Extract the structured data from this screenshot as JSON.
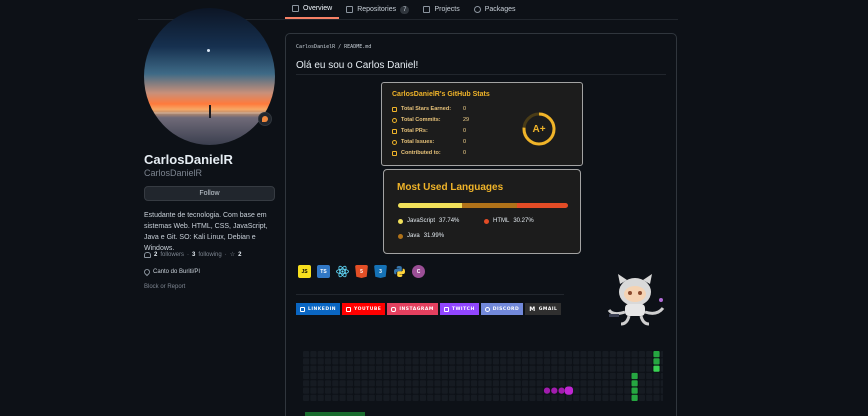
{
  "tabs": [
    {
      "label": "Overview",
      "icon": "book-icon",
      "active": true
    },
    {
      "label": "Repositories",
      "icon": "repo-icon",
      "count": "7"
    },
    {
      "label": "Projects",
      "icon": "table-icon"
    },
    {
      "label": "Packages",
      "icon": "package-icon"
    }
  ],
  "profile": {
    "fullname": "CarlosDanielR",
    "username": "CarlosDanielR",
    "follow_label": "Follow",
    "bio": "Estudante de tecnologia. Com base em sistemas Web. HTML, CSS, JavaScript, Java e Git. SO: Kali Linux, Debian e Windows.",
    "followers_count": "2",
    "followers_label": "followers",
    "separator": "·",
    "following_count": "3",
    "following_label": "following",
    "stars_count": "2",
    "location": "Canto do Buriti/PI",
    "block_label": "Block or Report"
  },
  "readme": {
    "path": "CarlosDanielR / README.md",
    "title": "Olá eu sou o Carlos Daniel!"
  },
  "stats_card": {
    "title": "CarlosDanielR's GitHub Stats",
    "rows": [
      {
        "label": "Total Stars Earned:",
        "value": "0",
        "icon": "star-icon"
      },
      {
        "label": "Total Commits:",
        "value": "29",
        "icon": "history-icon"
      },
      {
        "label": "Total PRs:",
        "value": "0",
        "icon": "pull-request-icon"
      },
      {
        "label": "Total Issues:",
        "value": "0",
        "icon": "issue-icon"
      },
      {
        "label": "Contributed to:",
        "value": "0",
        "icon": "repo-icon"
      }
    ],
    "grade": "A+",
    "accent": "#f0b429"
  },
  "languages_card": {
    "title": "Most Used Languages",
    "languages": [
      {
        "name": "JavaScript",
        "percent": "37.74%",
        "value": 37.74,
        "color": "#f1e05a"
      },
      {
        "name": "HTML",
        "percent": "30.27%",
        "value": 30.27,
        "color": "#e34c26"
      },
      {
        "name": "Java",
        "percent": "31.99%",
        "value": 31.99,
        "color": "#b07219"
      }
    ]
  },
  "techs": [
    {
      "label": "JS",
      "icon": "javascript-icon",
      "bg": "#f7df1e",
      "fg": "#000000"
    },
    {
      "label": "TS",
      "icon": "typescript-icon",
      "bg": "#3178c6",
      "fg": "#ffffff"
    },
    {
      "label": "",
      "icon": "react-icon",
      "bg": "transparent",
      "fg": "#61dafb"
    },
    {
      "label": "5",
      "icon": "html5-icon",
      "bg": "#e34f26",
      "fg": "#ffffff"
    },
    {
      "label": "3",
      "icon": "css3-icon",
      "bg": "#1572b6",
      "fg": "#ffffff"
    },
    {
      "label": "",
      "icon": "python-icon",
      "bg": "transparent",
      "fg": "#3776ab"
    },
    {
      "label": "C",
      "icon": "csharp-icon",
      "bg": "#9b4f96",
      "fg": "#ffffff"
    }
  ],
  "socials": [
    {
      "label": "LINKEDIN",
      "icon": "linkedin-icon",
      "color": "#0a66c2"
    },
    {
      "label": "YOUTUBE",
      "icon": "youtube-icon",
      "color": "#ff0000"
    },
    {
      "label": "INSTAGRAM",
      "icon": "instagram-icon",
      "color": "#e4405f"
    },
    {
      "label": "TWITCH",
      "icon": "twitch-icon",
      "color": "#9146ff"
    },
    {
      "label": "DISCORD",
      "icon": "discord-icon",
      "color": "#7289da"
    },
    {
      "label": "GMAIL",
      "icon": "gmail-icon",
      "color": "#2f2f2f"
    }
  ]
}
